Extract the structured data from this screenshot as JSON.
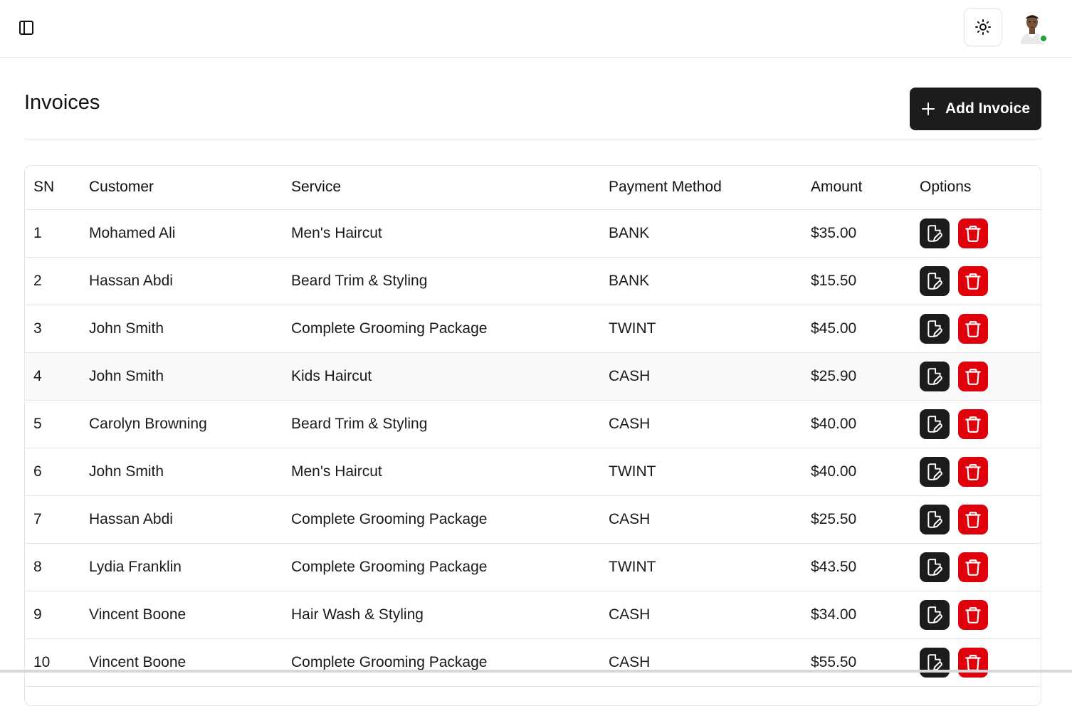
{
  "header": {
    "sidebar_toggle_icon": "panel-left-icon",
    "theme_toggle_icon": "sun-icon",
    "avatar_status_color": "#1fa33a"
  },
  "page": {
    "title": "Invoices",
    "add_button_label": "Add Invoice",
    "add_button_color": "#1c1c1c"
  },
  "table": {
    "columns": [
      "SN",
      "Customer",
      "Service",
      "Payment Method",
      "Amount",
      "Options"
    ],
    "edit_icon": "file-edit-icon",
    "delete_icon": "trash-icon",
    "edit_color": "#1c1c1c",
    "delete_color": "#e0000b",
    "rows": [
      {
        "sn": "1",
        "customer": "Mohamed Ali",
        "service": "Men's Haircut",
        "payment": "BANK",
        "amount": "$35.00"
      },
      {
        "sn": "2",
        "customer": "Hassan Abdi",
        "service": "Beard Trim & Styling",
        "payment": "BANK",
        "amount": "$15.50"
      },
      {
        "sn": "3",
        "customer": "John Smith",
        "service": "Complete Grooming Package",
        "payment": "TWINT",
        "amount": "$45.00"
      },
      {
        "sn": "4",
        "customer": "John Smith",
        "service": "Kids Haircut",
        "payment": "CASH",
        "amount": "$25.90"
      },
      {
        "sn": "5",
        "customer": "Carolyn Browning",
        "service": "Beard Trim & Styling",
        "payment": "CASH",
        "amount": "$40.00"
      },
      {
        "sn": "6",
        "customer": "John Smith",
        "service": "Men's Haircut",
        "payment": "TWINT",
        "amount": "$40.00"
      },
      {
        "sn": "7",
        "customer": "Hassan Abdi",
        "service": "Complete Grooming Package",
        "payment": "CASH",
        "amount": "$25.50"
      },
      {
        "sn": "8",
        "customer": "Lydia Franklin",
        "service": "Complete Grooming Package",
        "payment": "TWINT",
        "amount": "$43.50"
      },
      {
        "sn": "9",
        "customer": "Vincent Boone",
        "service": "Hair Wash & Styling",
        "payment": "CASH",
        "amount": "$34.00"
      },
      {
        "sn": "10",
        "customer": "Vincent Boone",
        "service": "Complete Grooming Package",
        "payment": "CASH",
        "amount": "$55.50"
      }
    ]
  }
}
